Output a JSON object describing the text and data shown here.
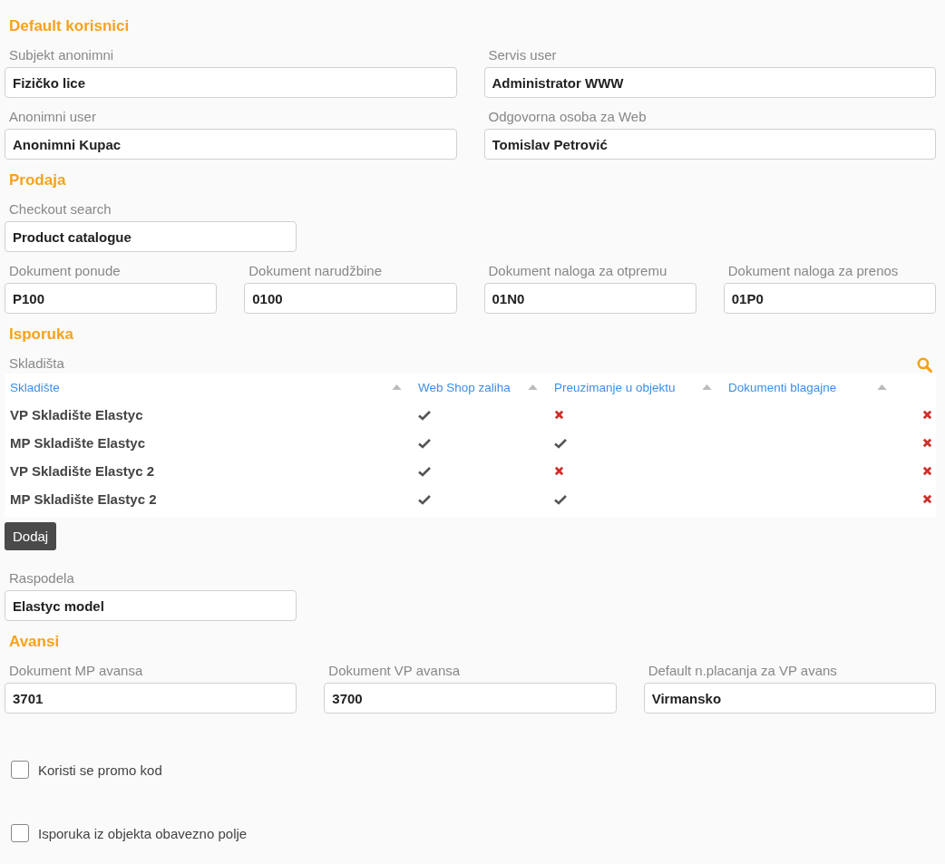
{
  "sections": [
    {
      "title": "Default korisnici",
      "blocks": [
        {
          "kind": "fields",
          "rows": [
            [
              {
                "label": "Subjekt anonimni",
                "value": "Fizičko lice"
              },
              {
                "label": "Servis user",
                "value": "Administrator WWW"
              }
            ],
            [
              {
                "label": "Anonimni user",
                "value": "Anonimni Kupac"
              },
              {
                "label": "Odgovorna osoba za Web",
                "value": "Tomislav Petrović"
              }
            ]
          ]
        }
      ]
    },
    {
      "title": "Prodaja",
      "blocks": [
        {
          "kind": "fields",
          "rows": [
            [
              {
                "label": "Checkout search",
                "value": "Product catalogue"
              }
            ],
            [
              {
                "label": "Dokument ponude",
                "value": "P100"
              },
              {
                "label": "Dokument narudžbine",
                "value": "0100"
              },
              {
                "label": "Dokument naloga za otpremu",
                "value": "01N0"
              },
              {
                "label": "Dokument naloga za prenos",
                "value": "01P0"
              }
            ]
          ]
        }
      ]
    },
    {
      "title": "Isporuka",
      "blocks": [
        {
          "kind": "table",
          "label": "Skladišta",
          "columns": [
            "Skladište",
            "Web Shop zaliha",
            "Preuzimanje u objektu",
            "Dokumenti blagajne"
          ],
          "rows": [
            {
              "name": "VP Skladište Elastyc",
              "web_shop": true,
              "pickup": false
            },
            {
              "name": "MP Skladište Elastyc",
              "web_shop": true,
              "pickup": true
            },
            {
              "name": "VP Skladište Elastyc 2",
              "web_shop": true,
              "pickup": false
            },
            {
              "name": "MP Skladište Elastyc 2",
              "web_shop": true,
              "pickup": true
            }
          ]
        },
        {
          "kind": "button",
          "label": "Dodaj"
        },
        {
          "kind": "fields",
          "rows": [
            [
              {
                "label": "Raspodela",
                "value": "Elastyc model"
              }
            ]
          ]
        }
      ]
    },
    {
      "title": "Avansi",
      "blocks": [
        {
          "kind": "fields",
          "rows": [
            [
              {
                "label": "Dokument MP avansa",
                "value": "3701"
              },
              {
                "label": "Dokument VP avansa",
                "value": "3700"
              },
              {
                "label": "Default n.placanja za VP avans",
                "value": "Virmansko"
              }
            ]
          ]
        }
      ]
    }
  ],
  "options": [
    {
      "label": "Koristi se promo kod",
      "checked": false
    },
    {
      "label": "Isporuka iz objekta obavezno polje",
      "checked": false
    }
  ]
}
